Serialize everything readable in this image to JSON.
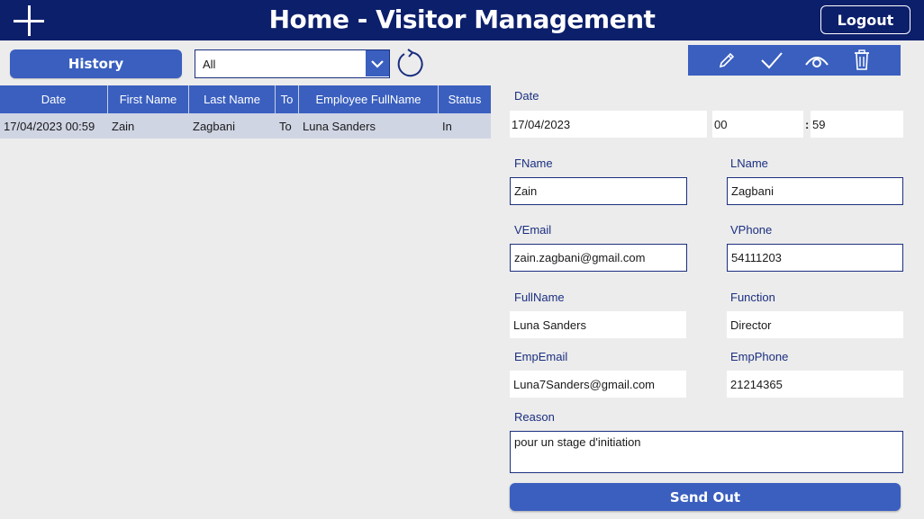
{
  "header": {
    "title": "Home - Visitor Management",
    "logout_label": "Logout",
    "add_icon": "plus-icon"
  },
  "controls": {
    "history_label": "History",
    "filter_selected": "All",
    "refresh_icon": "refresh-icon"
  },
  "toolbar": {
    "icons": [
      "edit-icon",
      "check-icon",
      "view-icon",
      "delete-icon"
    ]
  },
  "grid": {
    "columns": [
      "Date",
      "First Name",
      "Last Name",
      "To",
      "Employee FullName",
      "Status"
    ],
    "rows": [
      {
        "date": "17/04/2023 00:59",
        "first_name": "Zain",
        "last_name": "Zagbani",
        "to": "To",
        "employee": "Luna Sanders",
        "status": "In"
      }
    ]
  },
  "form": {
    "date_label": "Date",
    "date_value": "17/04/2023",
    "hour_value": "00",
    "time_separator": ":",
    "minute_value": "59",
    "fname_label": "FName",
    "fname_value": "Zain",
    "lname_label": "LName",
    "lname_value": "Zagbani",
    "vemail_label": "VEmail",
    "vemail_value": "zain.zagbani@gmail.com",
    "vphone_label": "VPhone",
    "vphone_value": "54111203",
    "fullname_label": "FullName",
    "fullname_value": "Luna Sanders",
    "function_label": "Function",
    "function_value": "Director",
    "empemail_label": "EmpEmail",
    "empemail_value": "Luna7Sanders@gmail.com",
    "empphone_label": "EmpPhone",
    "empphone_value": "21214365",
    "reason_label": "Reason",
    "reason_value": "pour un stage d'initiation",
    "send_label": "Send Out"
  },
  "colors": {
    "header_bg": "#0c1f6b",
    "accent": "#3a5fbf",
    "border": "#1b2f80",
    "row_bg": "#d0d5e4",
    "page_bg": "#ececec"
  }
}
